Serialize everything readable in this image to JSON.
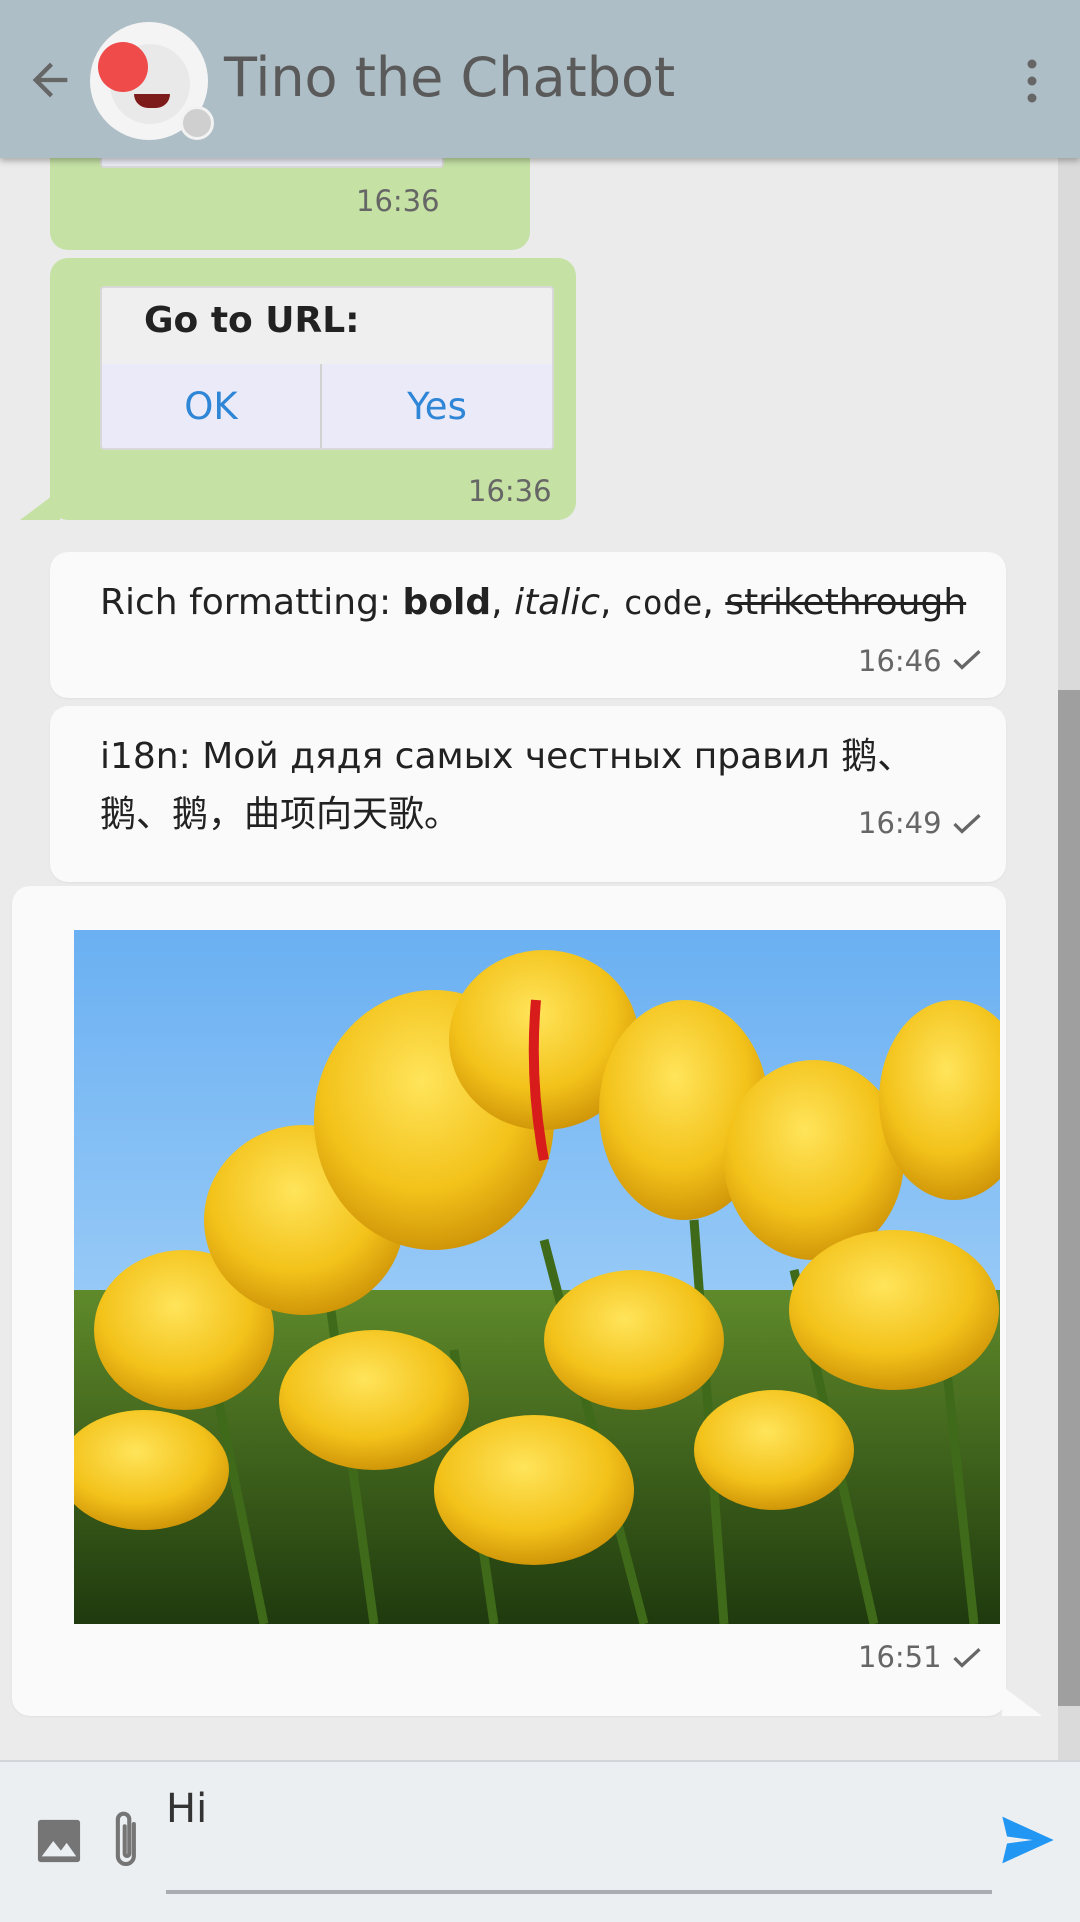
{
  "header": {
    "title": "Tino the Chatbot",
    "back_icon": "arrow-left-icon",
    "menu_icon": "more-vertical-icon"
  },
  "messages": [
    {
      "type": "incoming",
      "time": "16:36"
    },
    {
      "type": "incoming-form",
      "form_title": "Go to URL:",
      "buttons": [
        "OK",
        "Yes"
      ],
      "time": "16:36"
    },
    {
      "type": "outgoing",
      "text_parts": [
        "Rich formatting: ",
        "bold",
        ", ",
        "italic",
        ", ",
        "code",
        ", ",
        "strikethrough"
      ],
      "time": "16:46",
      "status": "sent"
    },
    {
      "type": "outgoing",
      "text": "i18n: Мой дядя самых честных правил 鹅、鹅、鹅，曲项向天歌。",
      "time": "16:49",
      "status": "sent"
    },
    {
      "type": "outgoing-image",
      "image": "yellow-tulips-photo",
      "time": "16:51",
      "status": "sent"
    }
  ],
  "composer": {
    "value": "Hi",
    "image_icon": "image-icon",
    "attach_icon": "paperclip-icon",
    "send_icon": "send-icon"
  },
  "colors": {
    "appbar": "#aebec6",
    "incoming_bubble": "#c5e1a4",
    "outgoing_bubble": "#fafafa",
    "button_text": "#2f86d6",
    "send_accent": "#2196f3"
  }
}
